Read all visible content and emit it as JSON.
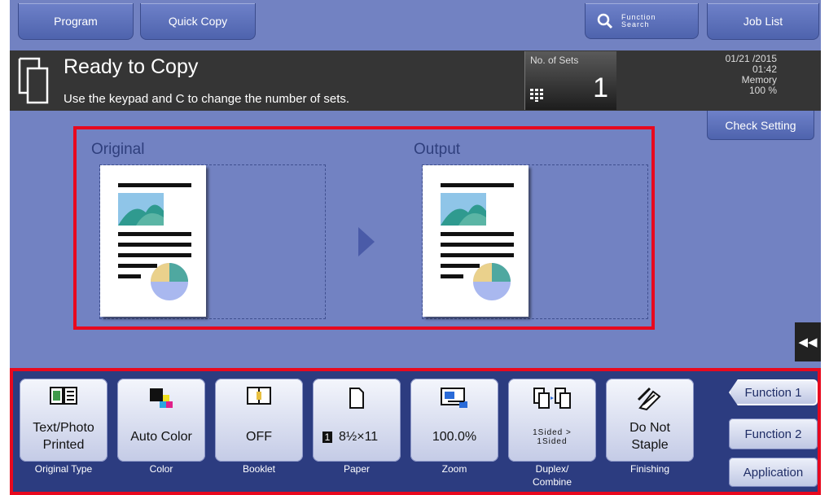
{
  "topbar": {
    "program": "Program",
    "quick_copy": "Quick Copy",
    "function_search_line1": "Function",
    "function_search_line2": "Search",
    "job_list": "Job List"
  },
  "status": {
    "title": "Ready to Copy",
    "message": "Use the keypad and C to change the number of sets.",
    "sets_label": "No. of Sets",
    "sets_value": "1",
    "date": "01/21 /2015",
    "time": "01:42",
    "memory_label": "Memory",
    "memory_value": "100 %"
  },
  "check_setting": "Check Setting",
  "preview": {
    "original_label": "Original",
    "output_label": "Output"
  },
  "function_keys": [
    {
      "line1": "Text/Photo",
      "line2": "Printed",
      "caption": "Original Type"
    },
    {
      "line1": "Auto Color",
      "caption": "Color"
    },
    {
      "line1": "OFF",
      "caption": "Booklet"
    },
    {
      "line1": "8½×11",
      "caption": "Paper"
    },
    {
      "line1": "100.0%",
      "caption": "Zoom"
    },
    {
      "line1": "1Sided >",
      "line2": "1Sided",
      "caption": "Duplex/",
      "caption2": "Combine"
    },
    {
      "line1": "Do Not",
      "line2": "Staple",
      "caption": "Finishing"
    }
  ],
  "side_buttons": {
    "function1": "Function 1",
    "function2": "Function 2",
    "application": "Application"
  },
  "colors": {
    "screen_bg": "#7282c2",
    "panel_bg": "#2c3c80",
    "highlight": "#e8091e",
    "status_bar": "#353535"
  }
}
